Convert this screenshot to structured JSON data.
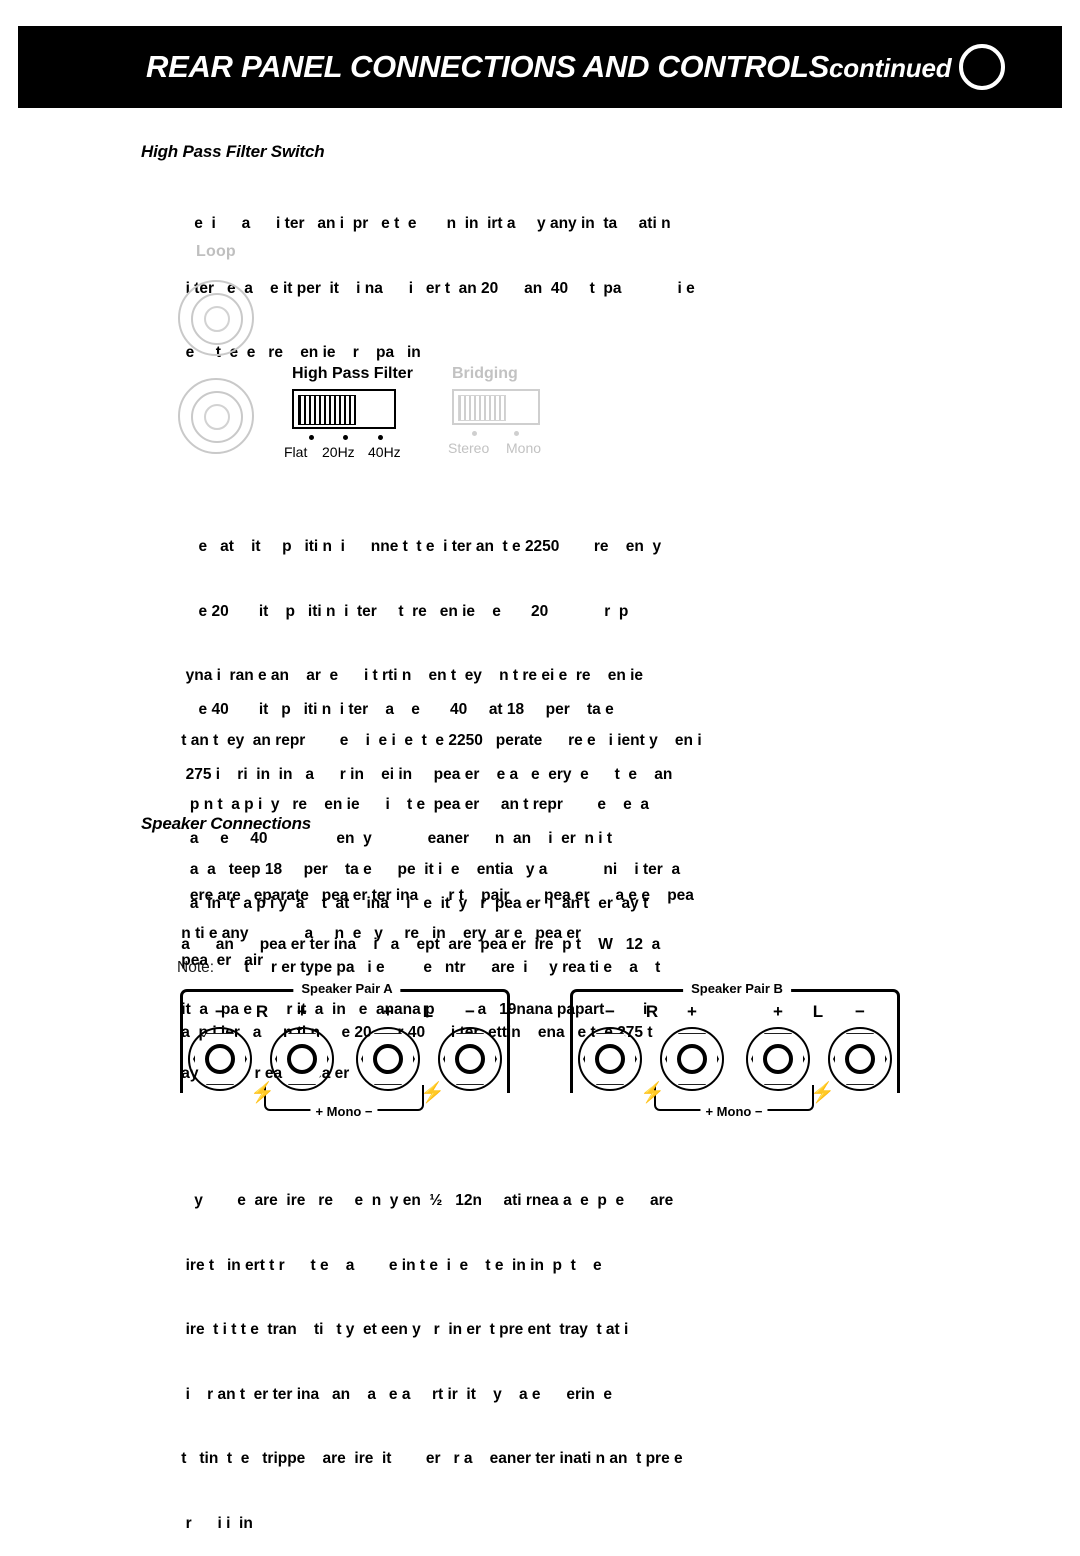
{
  "header": {
    "title_main": "REAR PANEL CONNECTIONS AND CONTROLS",
    "title_continued": "continued",
    "circle_icon": "circle-outline-icon"
  },
  "sections": {
    "high_pass_filter": {
      "heading": "High Pass Filter Switch",
      "intro_lines": [
        "    e  i      a      i ter   an i  pr   e t  e       n  in  irt a     y any in  ta     ati n",
        "  i ter   e  a    e it per  it    i na      i   er t  an 20      an  40     t  pa             i e",
        "  e     t  e  e   re    en ie    r    pa   in"
      ],
      "body_lines": [
        "     e   at    it     p   iti n  i      nne t  t e  i ter an  t e 2250        re    en  y",
        "     e 20       it    p   iti n  i  ter     t  re   en ie    e       20             r  p",
        "  yna i  ran e an    ar  e      i t rti n    en t  ey    n t re ei e  re    en ie",
        " t an t  ey  an repr        e    i  e i  e  t  e 2250   perate      re e   i ient y    en i",
        "   p n t  a p i  y   re    en ie      i    t e  pea er     an t repr        e    e  a",
        "   a  a   teep 18     per    ta e      pe  it i  e    entia   y a             ni    i ter  a",
        " n ti e any             a     n  e   y     re   in    ery  ar e   pea er"
      ],
      "body_lines_2": [
        "     e 40       it   p   iti n  i ter    a    e       40     at 18     per    ta e",
        "  275 i    ri  in  in   a      r in    ei in     pea er    e a   e  ery  e      t  e    an",
        "   a     e     40                en  y             eaner      n  an    i  er  n i t",
        "   a  in  t  a p i y  a    t  at    ina    i   e  it  y   r  pea er  i  an t  er  ay t"
      ],
      "note_label": "Note:",
      "note_lines": [
        "       t     r er type pa   i e         e   ntr      are  i     y rea ti e    a    t",
        " a  p i ier   a     n ti n     e 20      r 40      i ter  ettin    ena   e t  e 275 t"
      ]
    },
    "speaker_connections": {
      "heading": "Speaker Connections",
      "para_1_lines": [
        "   ere are   eparate   pea er ter ina       r t    pair        pea er      a e e    pea",
        " pea  er   air"
      ],
      "para_2_lines": [
        " a      an      pea er ter ina    i   a    ept  are  pea er  ire  p t    W   12  a",
        " it  a   pa e        r it  a  in   e  anana p          a   19nana papart         i",
        " ay  e   e    r ea     pea er"
      ]
    },
    "bottom_paragraph": {
      "lines": [
        "    y        e  are  ire   re     e  n  y en  ½   12n     ati rnea a  e  p  e      are",
        "  ire t   in ert t r      t e    a        e in t e  i  e    t e  in in  p  t    e",
        "  ire  t i t t e  tran    ti   t y  et een y   r  in er  t pre ent  tray  t at i",
        "  i    r an t  er ter ina   an    a   e a     rt ir  it    y    a e      erin  e",
        " t   tin  t  e   trippe    are  ire  it        er   r a    eaner ter inati n an  t pre e",
        "  r      i i  in"
      ]
    }
  },
  "diagram_top": {
    "loop_label": "Loop",
    "rca_jacks": [
      "loop-jack-upper",
      "loop-jack-lower"
    ],
    "high_pass_filter_switch": {
      "title": "High Pass Filter",
      "positions": [
        "Flat",
        "20Hz",
        "40Hz"
      ],
      "state": "active"
    },
    "bridging_switch": {
      "title": "Bridging",
      "positions": [
        "Stereo",
        "Mono"
      ],
      "state": "dimmed"
    }
  },
  "speaker_diagrams": [
    {
      "title": "Speaker Pair A",
      "terminal_marks": [
        "−",
        "R",
        "+",
        "+",
        "L",
        "−"
      ],
      "mono_label": "+ Mono −"
    },
    {
      "title": "Speaker Pair B",
      "terminal_marks": [
        "−",
        "R",
        "+",
        "+",
        "L",
        "−"
      ],
      "mono_label": "+ Mono −"
    }
  ],
  "colors": {
    "header_bg": "#000000",
    "header_text": "#ffffff",
    "body_text": "#000000",
    "dimmed": "#c2c2c2",
    "jack_outline": "#c9c9c9"
  }
}
